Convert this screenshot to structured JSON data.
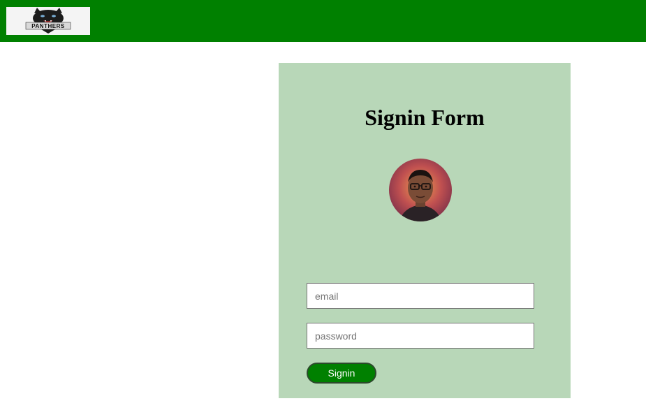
{
  "header": {
    "logo_text": "PANTHERS",
    "background_color": "#008000"
  },
  "form": {
    "title": "Signin Form",
    "background_color": "#b8d7b8",
    "avatar_icon": "user-avatar-cartoon",
    "email": {
      "placeholder": "email",
      "value": ""
    },
    "password": {
      "placeholder": "password",
      "value": ""
    },
    "submit_label": "Signin",
    "submit_color": "#008000"
  }
}
